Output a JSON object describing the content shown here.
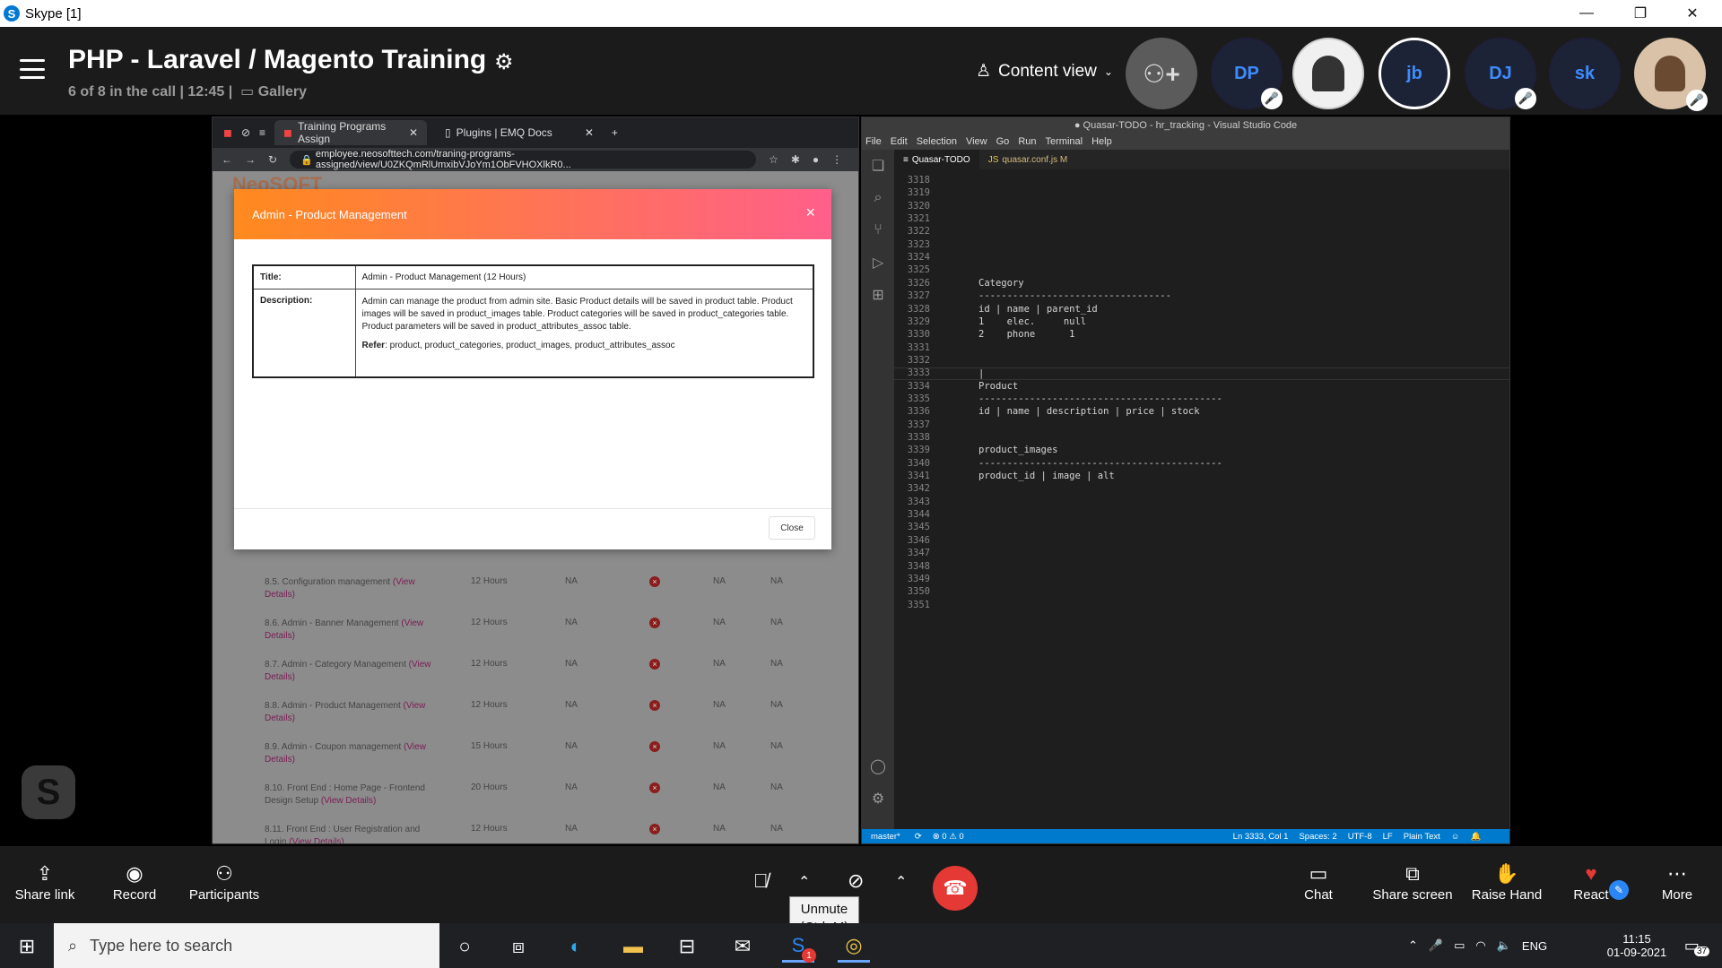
{
  "window": {
    "title": "Skype [1]",
    "controls": [
      "—",
      "❐",
      "✕"
    ]
  },
  "header": {
    "call_title": "PHP - Laravel / Magento Training",
    "call_subtitle": "6 of 8 in the call | 12:45 |",
    "gallery_label": "Gallery",
    "content_view_label": "Content view",
    "participants": [
      {
        "initials": "DP",
        "muted": true
      },
      {
        "initials": "",
        "muted": false
      },
      {
        "initials": "jb",
        "muted": false
      },
      {
        "initials": "DJ",
        "muted": true
      },
      {
        "initials": "sk",
        "muted": false
      }
    ]
  },
  "browser": {
    "tabs": [
      {
        "label": "Training Programs Assign"
      },
      {
        "label": "Plugins | EMQ Docs"
      }
    ],
    "url": "employee.neosofttech.com/traning-programs-assigned/view/U0ZKQmRlUmxibVJoYm1ObFVHOXlkR0...",
    "page_logo": "NeoSOFT",
    "modal": {
      "title": "Admin - Product Management",
      "rows": [
        {
          "key": "Title:",
          "value": "Admin - Product Management (12 Hours)"
        },
        {
          "key": "Description:",
          "value": "Admin can manage the product from admin site. Basic Product details will be saved in product table. Product images will be saved in product_images table. Product categories will be saved in product_categories table. Product parameters will be saved in product_attributes_assoc table.",
          "refer_label": "Refer",
          "refer_value": ": product, product_categories, product_images, product_attributes_assoc"
        }
      ],
      "close_label": "Close"
    },
    "list_rows": [
      {
        "title": "8.5. Configuration management",
        "view": "(View Details)",
        "hours": "12 Hours",
        "a": "NA",
        "b": "NA",
        "c": "NA"
      },
      {
        "title": "8.6. Admin - Banner Management",
        "view": "(View Details)",
        "hours": "12 Hours",
        "a": "NA",
        "b": "NA",
        "c": "NA"
      },
      {
        "title": "8.7. Admin - Category Management",
        "view": "(View Details)",
        "hours": "12 Hours",
        "a": "NA",
        "b": "NA",
        "c": "NA"
      },
      {
        "title": "8.8. Admin - Product Management",
        "view": "(View Details)",
        "hours": "12 Hours",
        "a": "NA",
        "b": "NA",
        "c": "NA"
      },
      {
        "title": "8.9. Admin - Coupon management",
        "view": "(View Details)",
        "hours": "15 Hours",
        "a": "NA",
        "b": "NA",
        "c": "NA"
      },
      {
        "title": "8.10. Front End : Home Page - Frontend Design Setup",
        "view": "(View Details)",
        "hours": "20 Hours",
        "a": "NA",
        "b": "NA",
        "c": "NA"
      },
      {
        "title": "8.11. Front End : User Registration and Login",
        "view": "(View Details)",
        "hours": "12 Hours",
        "a": "NA",
        "b": "NA",
        "c": "NA"
      }
    ]
  },
  "vscode": {
    "title": "● Quasar-TODO - hr_tracking - Visual Studio Code",
    "menu": [
      "File",
      "Edit",
      "Selection",
      "View",
      "Go",
      "Run",
      "Terminal",
      "Help"
    ],
    "tabs": [
      {
        "label": "Quasar-TODO"
      },
      {
        "label": "quasar.conf.js M"
      }
    ],
    "lines": [
      {
        "n": "3318",
        "t": ""
      },
      {
        "n": "3319",
        "t": ""
      },
      {
        "n": "3320",
        "t": ""
      },
      {
        "n": "3321",
        "t": ""
      },
      {
        "n": "3322",
        "t": ""
      },
      {
        "n": "3323",
        "t": ""
      },
      {
        "n": "3324",
        "t": ""
      },
      {
        "n": "3325",
        "t": ""
      },
      {
        "n": "3326",
        "t": "Category"
      },
      {
        "n": "3327",
        "t": "----------------------------------"
      },
      {
        "n": "3328",
        "t": "id | name | parent_id"
      },
      {
        "n": "3329",
        "t": "1    elec.     null"
      },
      {
        "n": "3330",
        "t": "2    phone      1"
      },
      {
        "n": "3331",
        "t": ""
      },
      {
        "n": "3332",
        "t": ""
      },
      {
        "n": "3333",
        "t": "|"
      },
      {
        "n": "3334",
        "t": "Product"
      },
      {
        "n": "3335",
        "t": "-------------------------------------------"
      },
      {
        "n": "3336",
        "t": "id | name | description | price | stock"
      },
      {
        "n": "3337",
        "t": ""
      },
      {
        "n": "3338",
        "t": ""
      },
      {
        "n": "3339",
        "t": "product_images"
      },
      {
        "n": "3340",
        "t": "-------------------------------------------"
      },
      {
        "n": "3341",
        "t": "product_id | image | alt"
      },
      {
        "n": "3342",
        "t": ""
      },
      {
        "n": "3343",
        "t": ""
      },
      {
        "n": "3344",
        "t": ""
      },
      {
        "n": "3345",
        "t": ""
      },
      {
        "n": "3346",
        "t": ""
      },
      {
        "n": "3347",
        "t": ""
      },
      {
        "n": "3348",
        "t": ""
      },
      {
        "n": "3349",
        "t": ""
      },
      {
        "n": "3350",
        "t": ""
      },
      {
        "n": "3351",
        "t": ""
      }
    ],
    "status": {
      "branch": "master*",
      "problems": "⊗ 0 ⚠ 0",
      "position": "Ln 3333, Col 1",
      "spaces": "Spaces: 2",
      "encoding": "UTF-8",
      "eol": "LF",
      "language": "Plain Text"
    }
  },
  "bottombar": {
    "share_link": "Share link",
    "record": "Record",
    "participants": "Participants",
    "chat": "Chat",
    "share_screen": "Share screen",
    "raise_hand": "Raise Hand",
    "react": "React",
    "more": "More",
    "tooltip": "Unmute (Ctrl+M)"
  },
  "taskbar": {
    "search_placeholder": "Type here to search",
    "language": "ENG",
    "time": "11:15",
    "date": "01-09-2021",
    "notifications": "37",
    "skype_badge": "1"
  },
  "colors": {
    "accent": "#0078d4",
    "hangup": "#e53935",
    "vscode_status": "#007acc"
  }
}
